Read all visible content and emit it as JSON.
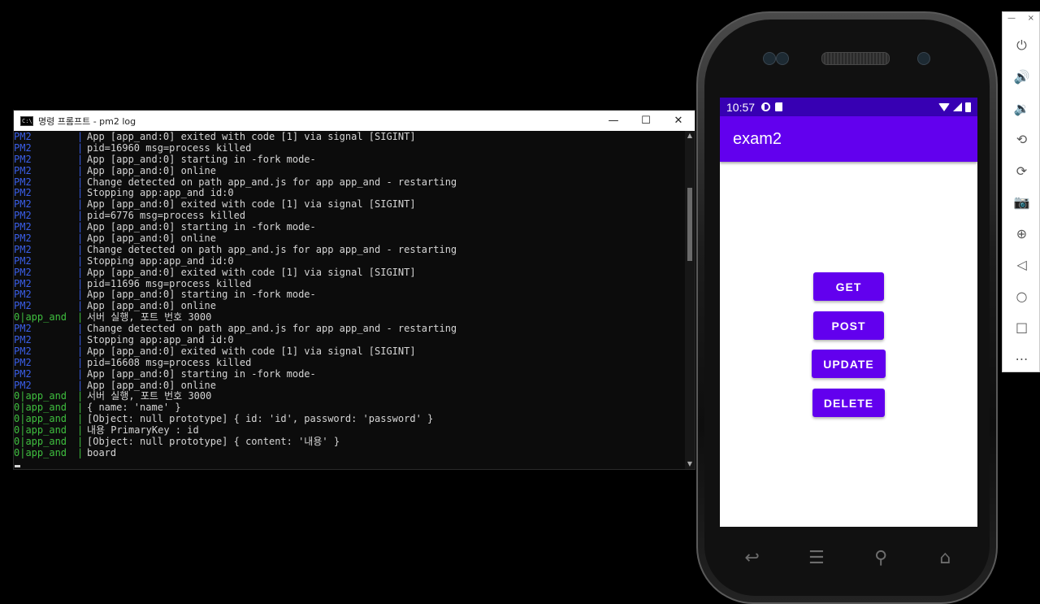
{
  "console": {
    "title": "명령 프롬프트 - pm2  log",
    "icon_text": "C:\\",
    "buttons": {
      "minimize": "—",
      "maximize": "☐",
      "close": "✕"
    },
    "rows": [
      {
        "src": "PM2",
        "type": "pm2",
        "msg": "App [app_and:0] exited with code [1] via signal [SIGINT]"
      },
      {
        "src": "PM2",
        "type": "pm2",
        "msg": "pid=16960 msg=process killed"
      },
      {
        "src": "PM2",
        "type": "pm2",
        "msg": "App [app_and:0] starting in -fork mode-"
      },
      {
        "src": "PM2",
        "type": "pm2",
        "msg": "App [app_and:0] online"
      },
      {
        "src": "PM2",
        "type": "pm2",
        "msg": "Change detected on path app_and.js for app app_and - restarting"
      },
      {
        "src": "PM2",
        "type": "pm2",
        "msg": "Stopping app:app_and id:0"
      },
      {
        "src": "PM2",
        "type": "pm2",
        "msg": "App [app_and:0] exited with code [1] via signal [SIGINT]"
      },
      {
        "src": "PM2",
        "type": "pm2",
        "msg": "pid=6776 msg=process killed"
      },
      {
        "src": "PM2",
        "type": "pm2",
        "msg": "App [app_and:0] starting in -fork mode-"
      },
      {
        "src": "PM2",
        "type": "pm2",
        "msg": "App [app_and:0] online"
      },
      {
        "src": "PM2",
        "type": "pm2",
        "msg": "Change detected on path app_and.js for app app_and - restarting"
      },
      {
        "src": "PM2",
        "type": "pm2",
        "msg": "Stopping app:app_and id:0"
      },
      {
        "src": "PM2",
        "type": "pm2",
        "msg": "App [app_and:0] exited with code [1] via signal [SIGINT]"
      },
      {
        "src": "PM2",
        "type": "pm2",
        "msg": "pid=11696 msg=process killed"
      },
      {
        "src": "PM2",
        "type": "pm2",
        "msg": "App [app_and:0] starting in -fork mode-"
      },
      {
        "src": "PM2",
        "type": "pm2",
        "msg": "App [app_and:0] online"
      },
      {
        "src": "0|app_and",
        "type": "app",
        "msg": "서버 실행, 포트 번호 3000"
      },
      {
        "src": "PM2",
        "type": "pm2",
        "msg": "Change detected on path app_and.js for app app_and - restarting"
      },
      {
        "src": "PM2",
        "type": "pm2",
        "msg": "Stopping app:app_and id:0"
      },
      {
        "src": "PM2",
        "type": "pm2",
        "msg": "App [app_and:0] exited with code [1] via signal [SIGINT]"
      },
      {
        "src": "PM2",
        "type": "pm2",
        "msg": "pid=16608 msg=process killed"
      },
      {
        "src": "PM2",
        "type": "pm2",
        "msg": "App [app_and:0] starting in -fork mode-"
      },
      {
        "src": "PM2",
        "type": "pm2",
        "msg": "App [app_and:0] online"
      },
      {
        "src": "0|app_and",
        "type": "app",
        "msg": "서버 실행, 포트 번호 3000"
      },
      {
        "src": "0|app_and",
        "type": "app",
        "msg": "{ name: 'name' }"
      },
      {
        "src": "0|app_and",
        "type": "app",
        "msg": "[Object: null prototype] { id: 'id', password: 'password' }"
      },
      {
        "src": "0|app_and",
        "type": "app",
        "msg": "내용 PrimaryKey : id"
      },
      {
        "src": "0|app_and",
        "type": "app",
        "msg": "[Object: null prototype] { content: '내용' }"
      },
      {
        "src": "0|app_and",
        "type": "app",
        "msg": "board"
      }
    ]
  },
  "phone": {
    "status_time": "10:57",
    "app_title": "exam2",
    "buttons": {
      "get": "GET",
      "post": "POST",
      "update": "UPDATE",
      "delete": "DELETE"
    },
    "colors": {
      "status_bar": "#3700b3",
      "app_bar": "#6200ee",
      "button": "#6200ee"
    }
  },
  "toolbar": {
    "minimize": "—",
    "close": "×",
    "icons": [
      "power-icon",
      "volume-up-icon",
      "volume-down-icon",
      "rotate-left-icon",
      "rotate-right-icon",
      "camera-icon",
      "zoom-icon",
      "back-icon",
      "home-icon",
      "overview-icon",
      "more-icon"
    ]
  }
}
